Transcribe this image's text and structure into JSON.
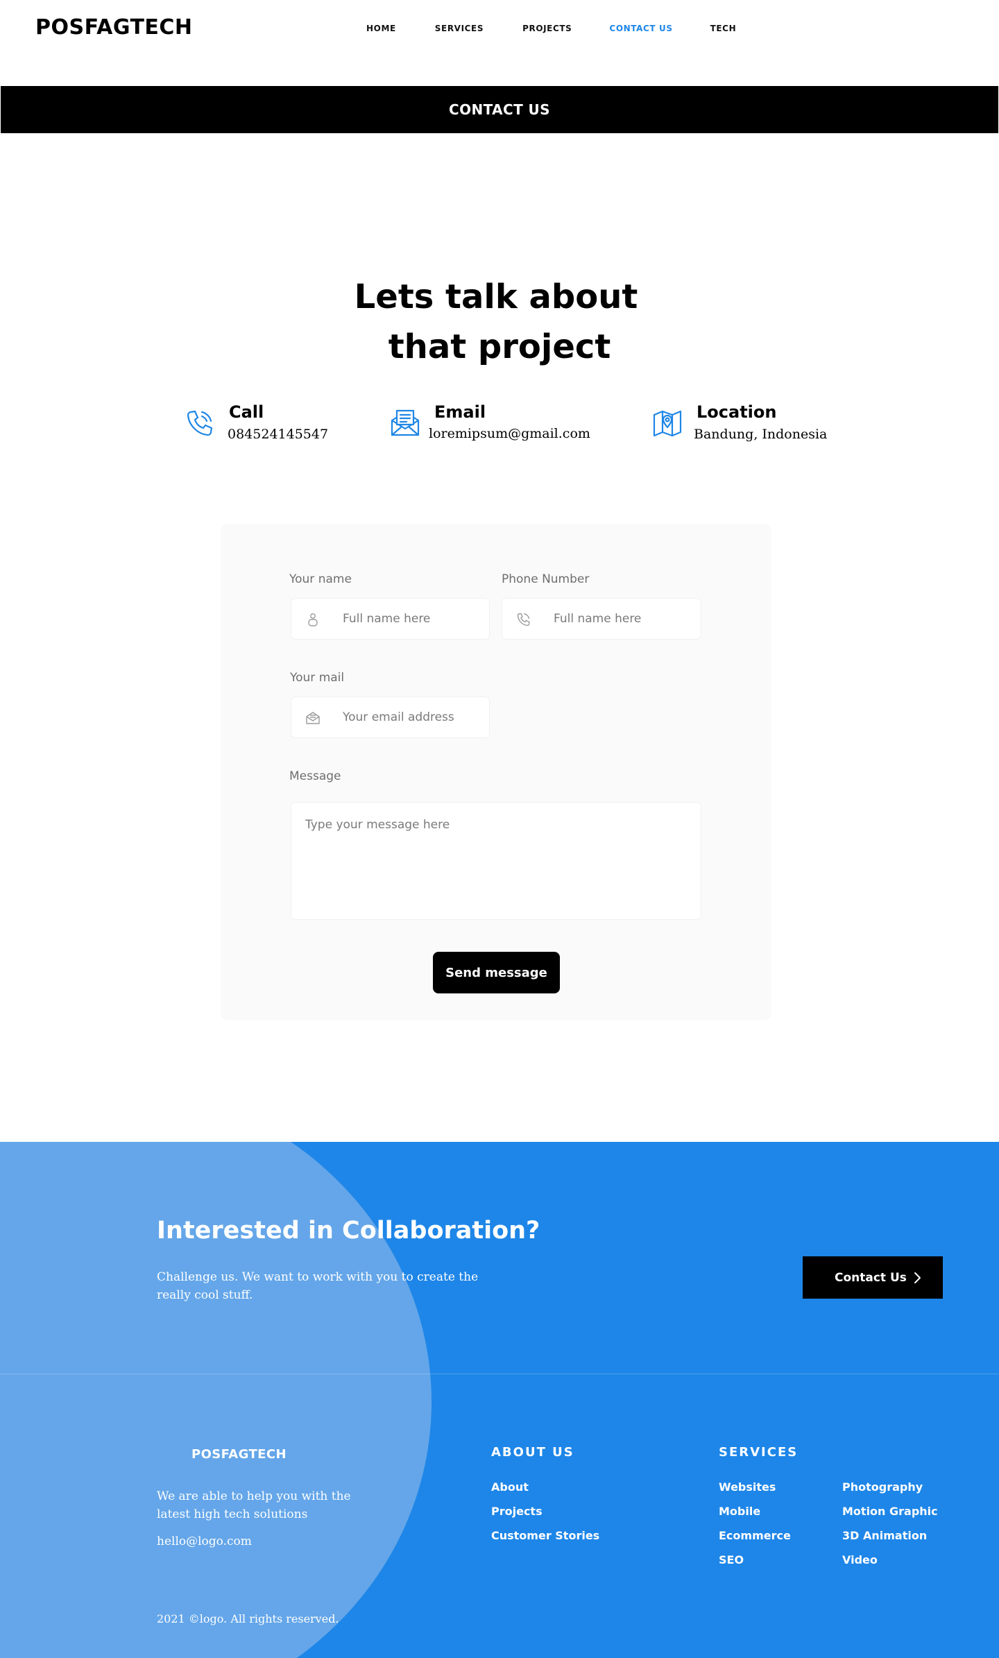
{
  "header": {
    "logo": "POSFAGTECH",
    "nav": [
      {
        "label": "HOME",
        "active": false
      },
      {
        "label": "SERVICES",
        "active": false
      },
      {
        "label": "PROJECTS",
        "active": false
      },
      {
        "label": "CONTACT US",
        "active": true
      },
      {
        "label": "TECH",
        "active": false
      }
    ]
  },
  "banner": {
    "title": "CONTACT US"
  },
  "hero": {
    "line1": "Lets talk about",
    "line2": "that project"
  },
  "contact_info": {
    "call": {
      "label": "Call",
      "value": "084524145547",
      "icon": "phone-icon"
    },
    "email": {
      "label": "Email",
      "value": "loremipsum@gmail.com",
      "icon": "mail-icon"
    },
    "location": {
      "label": "Location",
      "value": "Bandung, Indonesia",
      "icon": "map-pin-icon"
    }
  },
  "form": {
    "name": {
      "label": "Your name",
      "placeholder": "Full name here",
      "icon": "user-icon"
    },
    "phone": {
      "label": "Phone Number",
      "placeholder": "Full name here",
      "icon": "phone-icon"
    },
    "mail": {
      "label": "Your mail",
      "placeholder": "Your email address",
      "icon": "mail-icon"
    },
    "message": {
      "label": "Message",
      "placeholder": "Type your message here"
    },
    "submit_label": "Send message"
  },
  "collab": {
    "title": "Interested in Collaboration?",
    "text": "Challenge us. We want to work with you to create the really cool stuff.",
    "button_label": "Contact Us"
  },
  "footer": {
    "brand": "POSFAGTECH",
    "about_text": "We are able to help you with the latest high tech solutions",
    "email": "hello@logo.com",
    "copyright": "2021 ©logo. All rights reserved.",
    "about_heading": "ABOUT US",
    "about_links": [
      "About",
      "Projects",
      "Customer Stories"
    ],
    "services_heading": "SERVICES",
    "services_col1": [
      "Websites",
      "Mobile",
      "Ecommerce",
      "SEO"
    ],
    "services_col2": [
      "Photography",
      "Motion Graphic",
      "3D Animation",
      "Video"
    ]
  },
  "colors": {
    "accent": "#1e86e6",
    "footer_bg": "#1e86e8",
    "banner_bg": "#000000"
  }
}
